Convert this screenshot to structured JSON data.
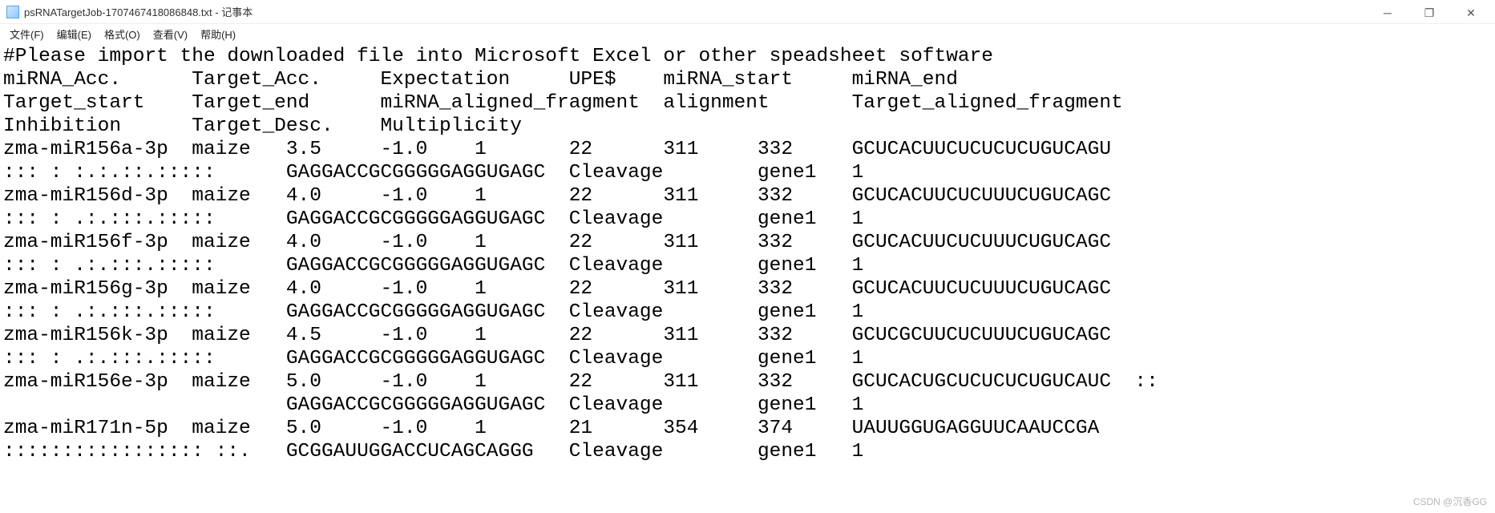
{
  "window": {
    "title": "psRNATargetJob-1707467418086848.txt - 记事本",
    "minimize": "─",
    "maximize": "❐",
    "close": "✕"
  },
  "menu": {
    "file": "文件(F)",
    "edit": "编辑(E)",
    "format": "格式(O)",
    "view": "查看(V)",
    "help": "帮助(H)"
  },
  "watermark": "CSDN @沉香GG",
  "lines": {
    "l0": "#Please import the downloaded file into Microsoft Excel or other speadsheet software",
    "l1": "miRNA_Acc.      Target_Acc.     Expectation     UPE$    miRNA_start     miRNA_end",
    "l2": "Target_start    Target_end      miRNA_aligned_fragment  alignment       Target_aligned_fragment",
    "l3": "Inhibition      Target_Desc.    Multiplicity",
    "l4": "zma-miR156a-3p  maize   3.5     -1.0    1       22      311     332     GCUCACUUCUCUCUCUGUCAGU",
    "l5": "::: : :.:.::.:::::      GAGGACCGCGGGGGAGGUGAGC  Cleavage        gene1   1",
    "l6": "zma-miR156d-3p  maize   4.0     -1.0    1       22      311     332     GCUCACUUCUCUUUCUGUCAGC",
    "l7": "::: : .:.:::.:::::      GAGGACCGCGGGGGAGGUGAGC  Cleavage        gene1   1",
    "l8": "zma-miR156f-3p  maize   4.0     -1.0    1       22      311     332     GCUCACUUCUCUUUCUGUCAGC",
    "l9": "::: : .:.:::.:::::      GAGGACCGCGGGGGAGGUGAGC  Cleavage        gene1   1",
    "l10": "zma-miR156g-3p  maize   4.0     -1.0    1       22      311     332     GCUCACUUCUCUUUCUGUCAGC",
    "l11": "::: : .:.:::.:::::      GAGGACCGCGGGGGAGGUGAGC  Cleavage        gene1   1",
    "l12": "zma-miR156k-3p  maize   4.5     -1.0    1       22      311     332     GCUCGCUUCUCUUUCUGUCAGC",
    "l13": "::: : .:.:::.:::::      GAGGACCGCGGGGGAGGUGAGC  Cleavage        gene1   1",
    "l14": "zma-miR156e-3p  maize   5.0     -1.0    1       22      311     332     GCUCACUGCUCUCUCUGUCAUC  ::",
    "l15": "                        GAGGACCGCGGGGGAGGUGAGC  Cleavage        gene1   1",
    "l16": "zma-miR171n-5p  maize   5.0     -1.0    1       21      354     374     UAUUGGUGAGGUUCAAUCCGA",
    "l17": "::::::::::::::::: ::.   GCGGAUUGGACCUCAGCAGGG   Cleavage        gene1   1"
  }
}
